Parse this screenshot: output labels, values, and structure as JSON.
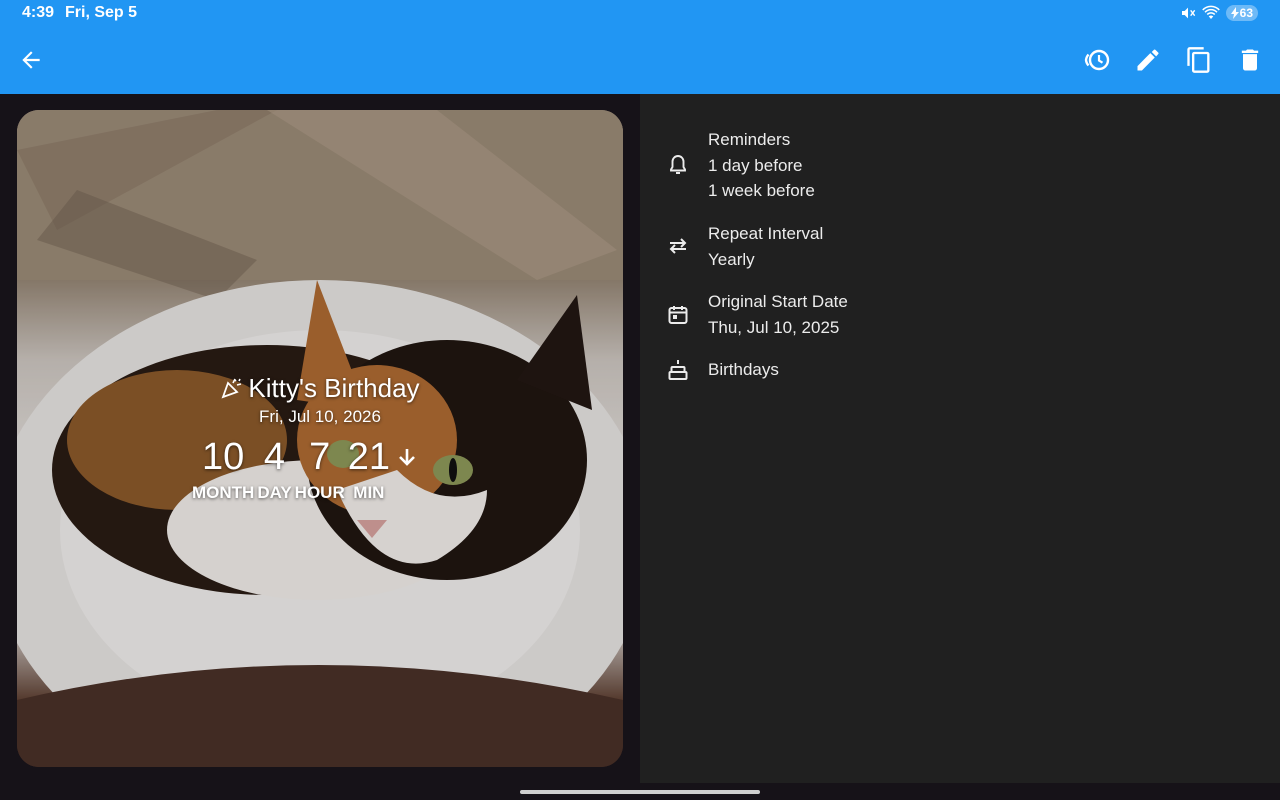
{
  "status_bar": {
    "time": "4:39",
    "date": "Fri, Sep 5",
    "battery": "63",
    "icons": [
      "mute-icon",
      "wifi-icon",
      "battery-charging-icon"
    ]
  },
  "app_bar": {
    "color": "#2196f3",
    "back_icon": "arrow-back-icon",
    "actions": [
      "history-icon",
      "edit-icon",
      "copy-icon",
      "delete-icon"
    ]
  },
  "event": {
    "icon": "party-popper-icon",
    "title": "Kitty's Birthday",
    "date": "Fri, Jul 10, 2026",
    "countdown": [
      {
        "value": "10",
        "label": "MONTH"
      },
      {
        "value": "4",
        "label": "DAY"
      },
      {
        "value": "7",
        "label": "HOUR"
      },
      {
        "value": "21",
        "label": "MIN"
      }
    ],
    "countdown_direction_icon": "arrow-down-icon"
  },
  "details": {
    "reminders": {
      "icon": "bell-icon",
      "label": "Reminders",
      "values": [
        "1 day before",
        "1 week before"
      ]
    },
    "repeat": {
      "icon": "repeat-icon",
      "label": "Repeat Interval",
      "value": "Yearly"
    },
    "start_date": {
      "icon": "calendar-icon",
      "label": "Original Start Date",
      "value": "Thu, Jul 10, 2025"
    },
    "category": {
      "icon": "cake-icon",
      "label": "Birthdays"
    }
  }
}
